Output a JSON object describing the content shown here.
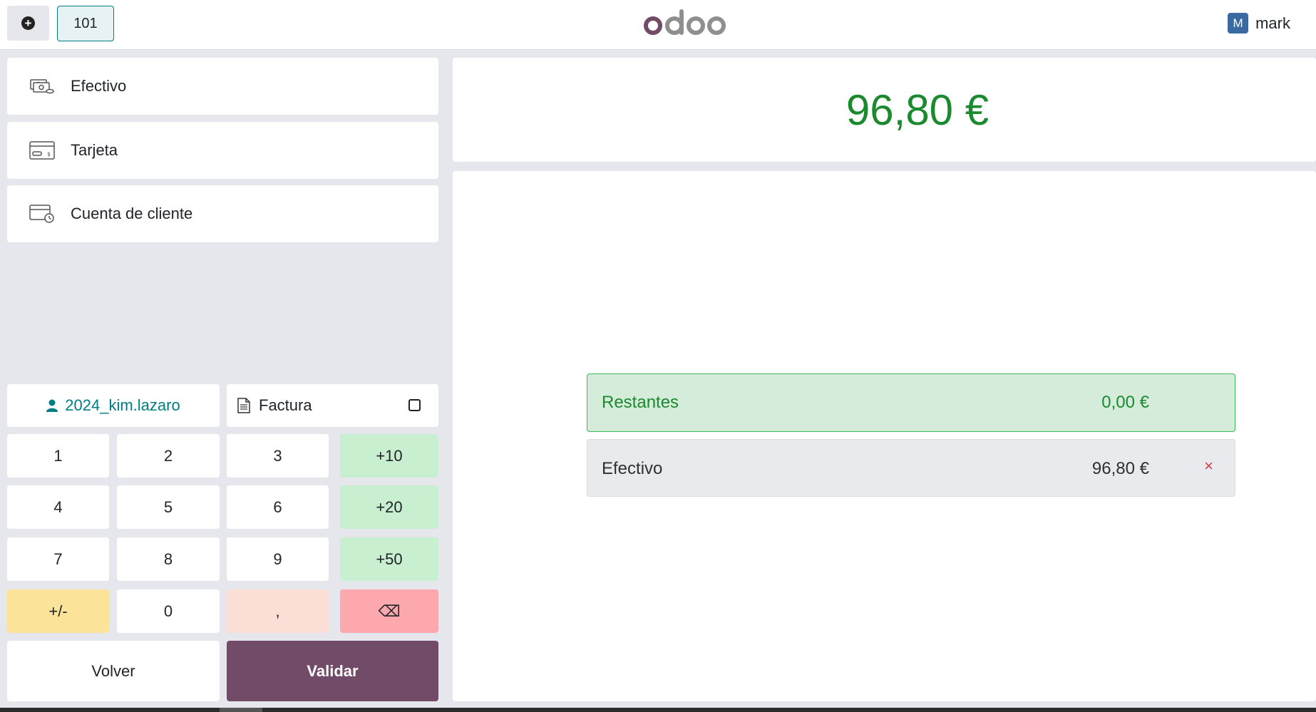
{
  "topbar": {
    "add_icon": "plus-circle-icon",
    "table_number": "101",
    "logo_text": "odoo",
    "user_initial": "M",
    "user_name": "mark"
  },
  "payment_methods": [
    {
      "label": "Efectivo",
      "icon": "cash-icon"
    },
    {
      "label": "Tarjeta",
      "icon": "card-icon"
    },
    {
      "label": "Cuenta de cliente",
      "icon": "customer-account-icon"
    }
  ],
  "customer": {
    "name": "2024_kim.lazaro",
    "icon": "user-icon"
  },
  "invoice": {
    "label": "Factura",
    "checked": false
  },
  "numpad": {
    "k1": "1",
    "k2": "2",
    "k3": "3",
    "p10": "+10",
    "k4": "4",
    "k5": "5",
    "k6": "6",
    "p20": "+20",
    "k7": "7",
    "k8": "8",
    "k9": "9",
    "p50": "+50",
    "sign": "+/-",
    "k0": "0",
    "comma": ",",
    "backspace": "⌫"
  },
  "actions": {
    "back": "Volver",
    "validate": "Validar"
  },
  "summary": {
    "total": "96,80 €",
    "remaining_label": "Restantes",
    "remaining_value": "0,00 €"
  },
  "payment_lines": [
    {
      "method": "Efectivo",
      "amount": "96,80 €",
      "delete_icon": "×"
    }
  ],
  "colors": {
    "brand": "#714b67",
    "accent": "#017e84",
    "success": "#1b8a2e"
  }
}
